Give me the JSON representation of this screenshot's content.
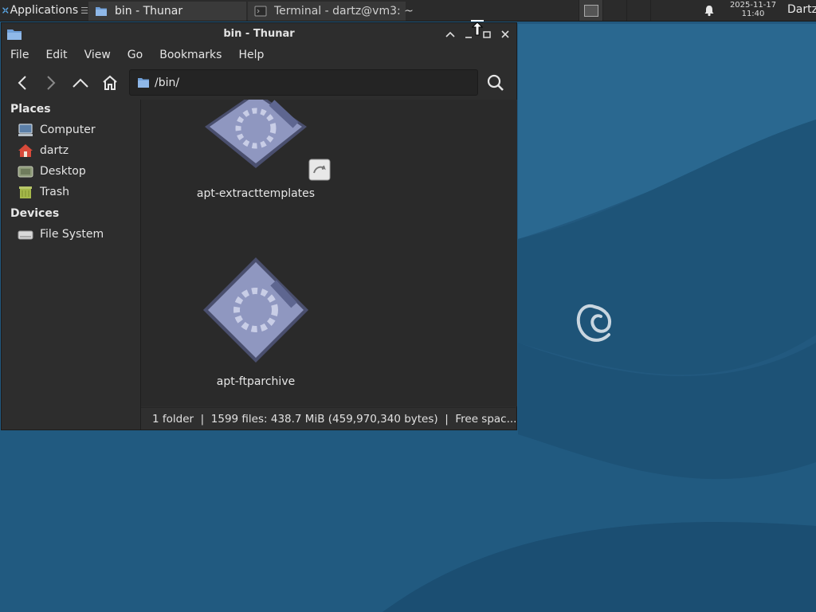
{
  "panel": {
    "applications_label": "Applications",
    "applications_suffix": "☰",
    "tasks": [
      {
        "label": "bin - Thunar",
        "icon": "folder-icon"
      },
      {
        "label": "Terminal - dartz@vm3: ~",
        "icon": "terminal-icon"
      }
    ],
    "date": "2025-11-17",
    "time": "11:40",
    "user": "Dartz"
  },
  "window": {
    "title": "bin - Thunar",
    "menu": [
      "File",
      "Edit",
      "View",
      "Go",
      "Bookmarks",
      "Help"
    ],
    "location_path": "/bin/",
    "sidebar": {
      "places_heading": "Places",
      "places": [
        {
          "label": "Computer",
          "icon": "computer-icon"
        },
        {
          "label": "dartz",
          "icon": "home-icon"
        },
        {
          "label": "Desktop",
          "icon": "desktop-icon"
        },
        {
          "label": "Trash",
          "icon": "trash-icon"
        }
      ],
      "devices_heading": "Devices",
      "devices": [
        {
          "label": "File System",
          "icon": "drive-icon"
        }
      ]
    },
    "files": [
      {
        "name": "apt-extracttemplates",
        "icon": "executable-icon",
        "symlink": true
      },
      {
        "name": "apt-ftparchive",
        "icon": "executable-icon",
        "symlink": false
      },
      {
        "name": "",
        "icon": "executable-icon",
        "symlink": false
      }
    ],
    "status": "1 folder  |  1599 files: 438.7 MiB (459,970,340 bytes)  |  Free spac..."
  },
  "colors": {
    "desktop_bg": "#22597f",
    "panel_bg": "#2b2b2b",
    "window_bg": "#2d2d2d",
    "folder_blue": "#6f9fd8"
  }
}
